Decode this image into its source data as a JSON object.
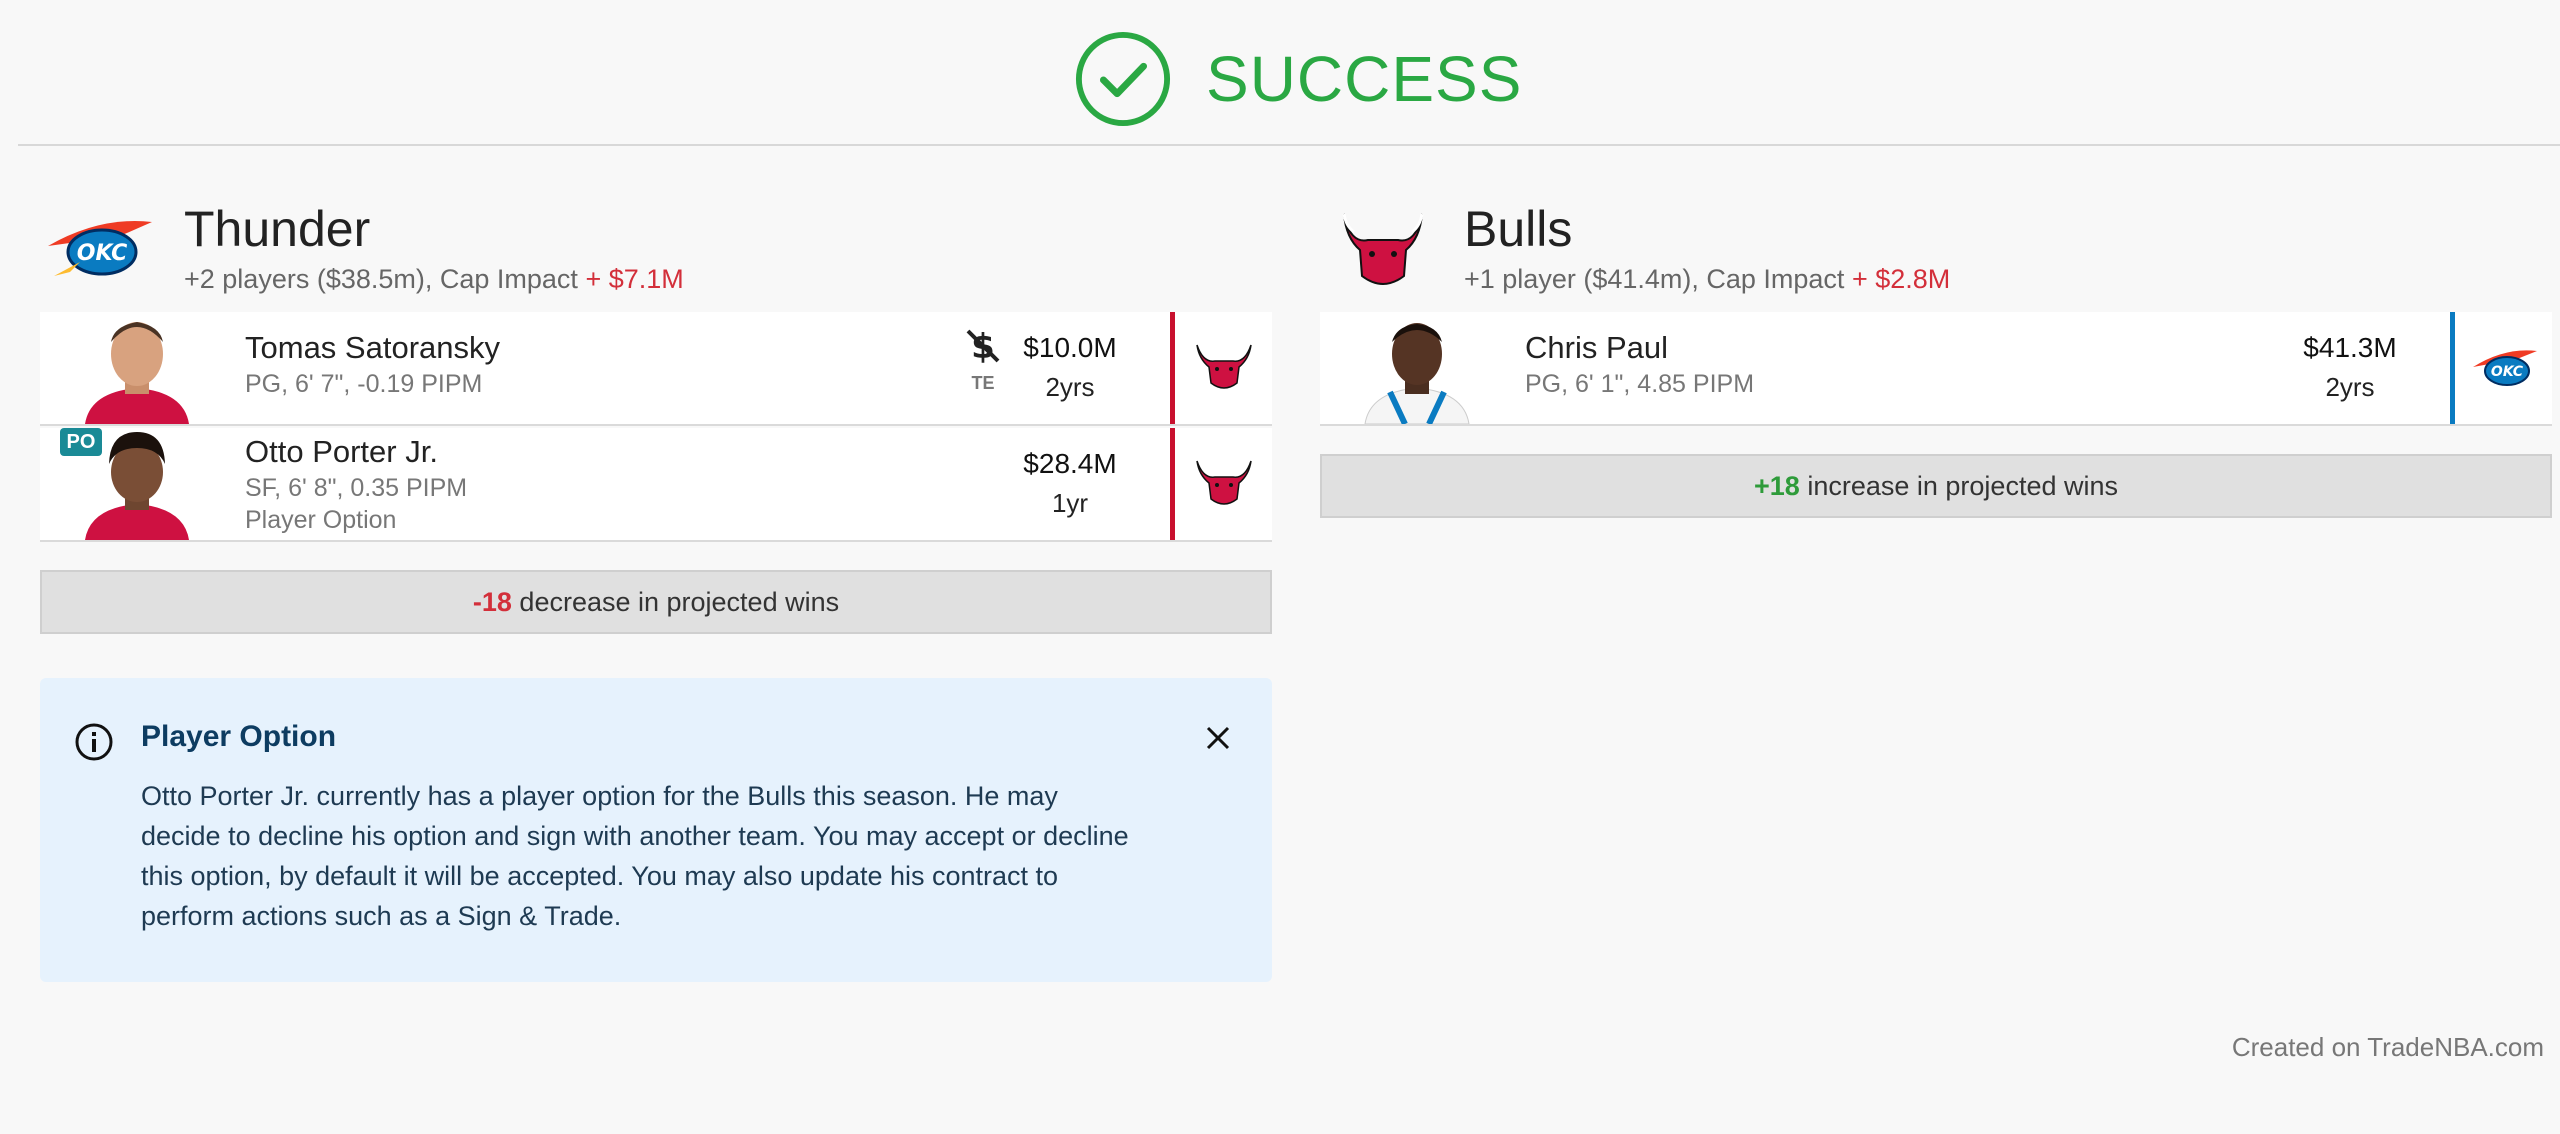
{
  "header": {
    "status": "SUCCESS"
  },
  "colors": {
    "success": "#2aa843",
    "negative": "#d32f3a",
    "positive": "#2e9b3a",
    "bulls_red": "#c8102e",
    "thunder_blue": "#0a7bc1"
  },
  "teams": [
    {
      "name": "Thunder",
      "summary": "+2 players ($38.5m), Cap Impact",
      "cap_impact": "+ $7.1M",
      "logo": "thunder-logo",
      "players": [
        {
          "name": "Tomas Satoransky",
          "detail": "PG, 6' 7\", -0.19 PIPM",
          "note": "",
          "salary": "$10.0M",
          "years": "2yrs",
          "te_label": "TE",
          "from_team_logo": "bulls-logo"
        },
        {
          "name": "Otto Porter Jr.",
          "detail": "SF, 6' 8\", 0.35 PIPM",
          "note": "Player Option",
          "badge": "PO",
          "salary": "$28.4M",
          "years": "1yr",
          "from_team_logo": "bulls-logo"
        }
      ],
      "wins_delta": "-18",
      "wins_text": "decrease in projected wins"
    },
    {
      "name": "Bulls",
      "summary": "+1 player ($41.4m), Cap Impact",
      "cap_impact": "+ $2.8M",
      "logo": "bulls-logo",
      "players": [
        {
          "name": "Chris Paul",
          "detail": "PG, 6' 1\", 4.85 PIPM",
          "salary": "$41.3M",
          "years": "2yrs",
          "from_team_logo": "thunder-logo"
        }
      ],
      "wins_delta": "+18",
      "wins_text": "increase in projected wins"
    }
  ],
  "alert": {
    "title": "Player Option",
    "body": "Otto Porter Jr. currently has a player option for the Bulls this season. He may decide to decline his option and sign with another team. You may accept or decline this option, by default it will be accepted. You may also update his contract to perform actions such as a Sign & Trade."
  },
  "footer": "Created on TradeNBA.com"
}
